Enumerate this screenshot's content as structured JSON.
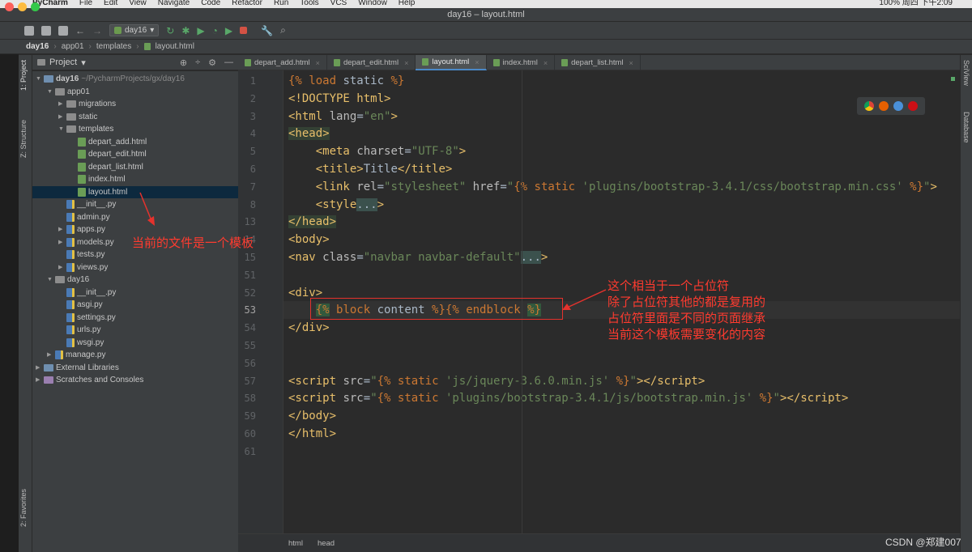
{
  "menubar": {
    "items": [
      "PyCharm",
      "File",
      "Edit",
      "View",
      "Navigate",
      "Code",
      "Refactor",
      "Run",
      "Tools",
      "VCS",
      "Window",
      "Help"
    ],
    "clock_text": "100%  周四 下午2:09"
  },
  "window": {
    "title": "day16 – layout.html"
  },
  "toolbar": {
    "run_config": "day16"
  },
  "breadcrumb": {
    "items": [
      "day16",
      "app01",
      "templates",
      "layout.html"
    ]
  },
  "side_tabs": {
    "project": "1: Project",
    "structure": "Z: Structure",
    "favorites": "2: Favorites"
  },
  "right_tabs": {
    "sciview": "SciView",
    "database": "Database"
  },
  "project_panel": {
    "title": "Project"
  },
  "tree": [
    {
      "label": "day16",
      "suffix": "~/PycharmProjects/gx/day16",
      "depth": 0,
      "kind": "folder",
      "open": true,
      "bold": true
    },
    {
      "label": "app01",
      "depth": 1,
      "kind": "folder",
      "open": true
    },
    {
      "label": "migrations",
      "depth": 2,
      "kind": "folder",
      "open": false
    },
    {
      "label": "static",
      "depth": 2,
      "kind": "folder",
      "open": false
    },
    {
      "label": "templates",
      "depth": 2,
      "kind": "folder",
      "open": true
    },
    {
      "label": "depart_add.html",
      "depth": 3,
      "kind": "html"
    },
    {
      "label": "depart_edit.html",
      "depth": 3,
      "kind": "html"
    },
    {
      "label": "depart_list.html",
      "depth": 3,
      "kind": "html"
    },
    {
      "label": "index.html",
      "depth": 3,
      "kind": "html"
    },
    {
      "label": "layout.html",
      "depth": 3,
      "kind": "html",
      "selected": true
    },
    {
      "label": "__init__.py",
      "depth": 2,
      "kind": "py"
    },
    {
      "label": "admin.py",
      "depth": 2,
      "kind": "py"
    },
    {
      "label": "apps.py",
      "depth": 2,
      "kind": "py",
      "collapsible": true
    },
    {
      "label": "models.py",
      "depth": 2,
      "kind": "py",
      "collapsible": true
    },
    {
      "label": "tests.py",
      "depth": 2,
      "kind": "py"
    },
    {
      "label": "views.py",
      "depth": 2,
      "kind": "py",
      "collapsible": true
    },
    {
      "label": "day16",
      "depth": 1,
      "kind": "folder",
      "open": true
    },
    {
      "label": "__init__.py",
      "depth": 2,
      "kind": "py"
    },
    {
      "label": "asgi.py",
      "depth": 2,
      "kind": "py"
    },
    {
      "label": "settings.py",
      "depth": 2,
      "kind": "py"
    },
    {
      "label": "urls.py",
      "depth": 2,
      "kind": "py"
    },
    {
      "label": "wsgi.py",
      "depth": 2,
      "kind": "py"
    },
    {
      "label": "manage.py",
      "depth": 1,
      "kind": "py",
      "collapsible": true
    },
    {
      "label": "External Libraries",
      "depth": 0,
      "kind": "lib",
      "open": false
    },
    {
      "label": "Scratches and Consoles",
      "depth": 0,
      "kind": "scratch",
      "open": false
    }
  ],
  "tabs": [
    {
      "label": "depart_add.html"
    },
    {
      "label": "depart_edit.html"
    },
    {
      "label": "layout.html",
      "active": true
    },
    {
      "label": "index.html"
    },
    {
      "label": "depart_list.html"
    }
  ],
  "code_lines": [
    {
      "num": "1",
      "html": "<span class=\"tp\">{%</span> <span class=\"kw\">load</span> static <span class=\"tp\">%}</span>"
    },
    {
      "num": "2",
      "html": "<span class=\"tag\">&lt;!DOCTYPE html&gt;</span>"
    },
    {
      "num": "3",
      "html": "<span class=\"tag\">&lt;html</span> <span class=\"att\">lang</span>=<span class=\"str\">\"en\"</span><span class=\"tag\">&gt;</span>"
    },
    {
      "num": "4",
      "html": "<span class=\"tag hl\">&lt;head&gt;</span>"
    },
    {
      "num": "5",
      "html": "    <span class=\"tag\">&lt;meta</span> <span class=\"att\">charset</span>=<span class=\"str\">\"UTF-8\"</span><span class=\"tag\">&gt;</span>"
    },
    {
      "num": "6",
      "html": "    <span class=\"tag\">&lt;title&gt;</span>Title<span class=\"tag\">&lt;/title&gt;</span>"
    },
    {
      "num": "7",
      "html": "    <span class=\"tag\">&lt;link</span> <span class=\"att\">rel</span>=<span class=\"str\">\"stylesheet\"</span> <span class=\"att\">href</span>=<span class=\"str\">\"</span><span class=\"tp\">{%</span> <span class=\"kw\">static</span> <span class=\"str\">'plugins/bootstrap-3.4.1/css/bootstrap.min.css'</span> <span class=\"tp\">%}</span><span class=\"str\">\"</span><span class=\"tag\">&gt;</span>"
    },
    {
      "num": "8",
      "html": "    <span class=\"tag\">&lt;style</span><span class=\"dots\">...</span><span class=\"tag\">&gt;</span>"
    },
    {
      "num": "13",
      "html": "<span class=\"tag hl\">&lt;/head&gt;</span>"
    },
    {
      "num": "14",
      "html": "<span class=\"tag\">&lt;body&gt;</span>"
    },
    {
      "num": "15",
      "html": "<span class=\"tag\">&lt;nav</span> <span class=\"att\">class</span>=<span class=\"str\">\"navbar navbar-default\"</span><span class=\"dots\">...</span><span class=\"tag\">&gt;</span>"
    },
    {
      "num": "51",
      "html": ""
    },
    {
      "num": "52",
      "html": "<span class=\"tag\">&lt;div&gt;</span>"
    },
    {
      "num": "53",
      "html": "    <span class=\"tp green\">{%</span> <span class=\"kw\">block</span> content <span class=\"tp\">%}{%</span> <span class=\"kw\">endblock</span> <span class=\"tp green\">%}</span>",
      "current": true
    },
    {
      "num": "54",
      "html": "<span class=\"tag\">&lt;/div&gt;</span>"
    },
    {
      "num": "55",
      "html": ""
    },
    {
      "num": "56",
      "html": ""
    },
    {
      "num": "57",
      "html": "<span class=\"tag\">&lt;script</span> <span class=\"att\">src</span>=<span class=\"str\">\"</span><span class=\"tp\">{%</span> <span class=\"kw\">static</span> <span class=\"str\">'js/jquery-3.6.0.min.js'</span> <span class=\"tp\">%}</span><span class=\"str\">\"</span><span class=\"tag\">&gt;&lt;/script&gt;</span>"
    },
    {
      "num": "58",
      "html": "<span class=\"tag\">&lt;script</span> <span class=\"att\">src</span>=<span class=\"str\">\"</span><span class=\"tp\">{%</span> <span class=\"kw\">static</span> <span class=\"str\">'plugins/bootstrap-3.4.1/js/bootstrap.min.js'</span> <span class=\"tp\">%}</span><span class=\"str\">\"</span><span class=\"tag\">&gt;&lt;/script&gt;</span>"
    },
    {
      "num": "59",
      "html": "<span class=\"tag\">&lt;/body&gt;</span>"
    },
    {
      "num": "60",
      "html": "<span class=\"tag\">&lt;/html&gt;</span>"
    },
    {
      "num": "61",
      "html": ""
    }
  ],
  "statusbar": {
    "path": [
      "html",
      "head"
    ]
  },
  "annotations": {
    "left_note": "当前的文件是一个模板",
    "right_note": "这个相当于一个占位符\n除了占位符其他的都是复用的\n占位符里面是不同的页面继承\n当前这个模板需要变化的内容"
  },
  "watermark": "CSDN @郑建007",
  "colors": {
    "annotation": "#e5322d",
    "selection": "#0d293e",
    "active_tab_underline": "#4a88c7"
  }
}
